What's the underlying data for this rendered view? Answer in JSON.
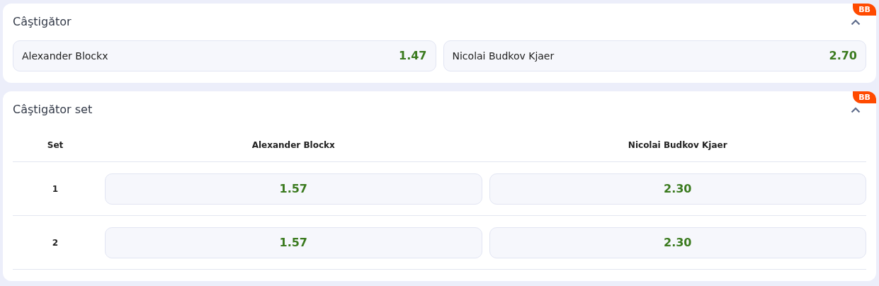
{
  "winner": {
    "title": "Câştigător",
    "badge": "BB",
    "expanded": true,
    "odds": [
      {
        "name": "Alexander Blockx",
        "price": "1.47"
      },
      {
        "name": "Nicolai Budkov Kjaer",
        "price": "2.70"
      }
    ]
  },
  "set_winner": {
    "title": "Câştigător set",
    "badge": "BB",
    "expanded": true,
    "columns": [
      "Set",
      "Alexander Blockx",
      "Nicolai Budkov Kjaer"
    ],
    "rows": [
      {
        "set": "1",
        "prices": [
          "1.57",
          "2.30"
        ]
      },
      {
        "set": "2",
        "prices": [
          "1.57",
          "2.30"
        ]
      }
    ]
  }
}
